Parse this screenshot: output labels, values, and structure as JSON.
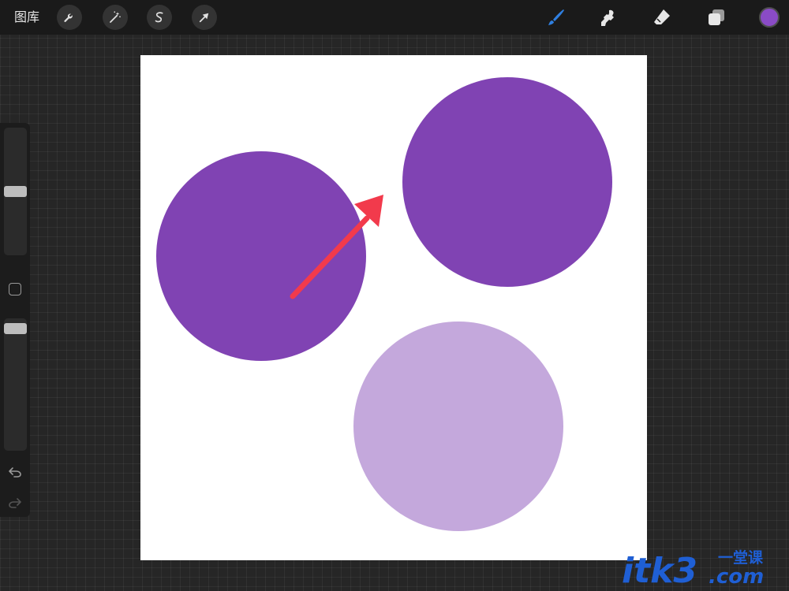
{
  "topbar": {
    "gallery_label": "图库",
    "left_tools": [
      {
        "name": "actions-tool",
        "icon": "wrench-icon"
      },
      {
        "name": "adjustments-tool",
        "icon": "magic-wand-icon"
      },
      {
        "name": "selection-tool",
        "icon": "selection-s-icon"
      },
      {
        "name": "transform-tool",
        "icon": "cursor-arrow-icon"
      }
    ],
    "right_tools": [
      {
        "name": "paint-brush-tool",
        "icon": "brush-icon",
        "active": true
      },
      {
        "name": "smudge-tool",
        "icon": "smudge-icon",
        "active": false
      },
      {
        "name": "eraser-tool",
        "icon": "eraser-icon",
        "active": false
      },
      {
        "name": "layers-tool",
        "icon": "layers-icon",
        "active": false
      }
    ],
    "current_color": "#8a4bc6",
    "active_tool_color": "#2f7fe0"
  },
  "sidebar": {
    "brush_size_level": 0.5,
    "brush_opacity_level": 0,
    "icons": [
      "square-icon",
      "undo-icon",
      "redo-icon"
    ]
  },
  "canvas": {
    "background": "#ffffff",
    "shapes": [
      {
        "name": "purple-circle-left",
        "color": "#8043b3"
      },
      {
        "name": "purple-circle-top-right",
        "color": "#8043b3"
      },
      {
        "name": "light-purple-circle-bottom",
        "color": "#c4a8dc"
      }
    ],
    "arrow_color": "#f23a4c"
  },
  "watermark": {
    "text": "itk3",
    "suffix": ".com",
    "tag": "一堂课",
    "color": "#1f5fd4"
  }
}
